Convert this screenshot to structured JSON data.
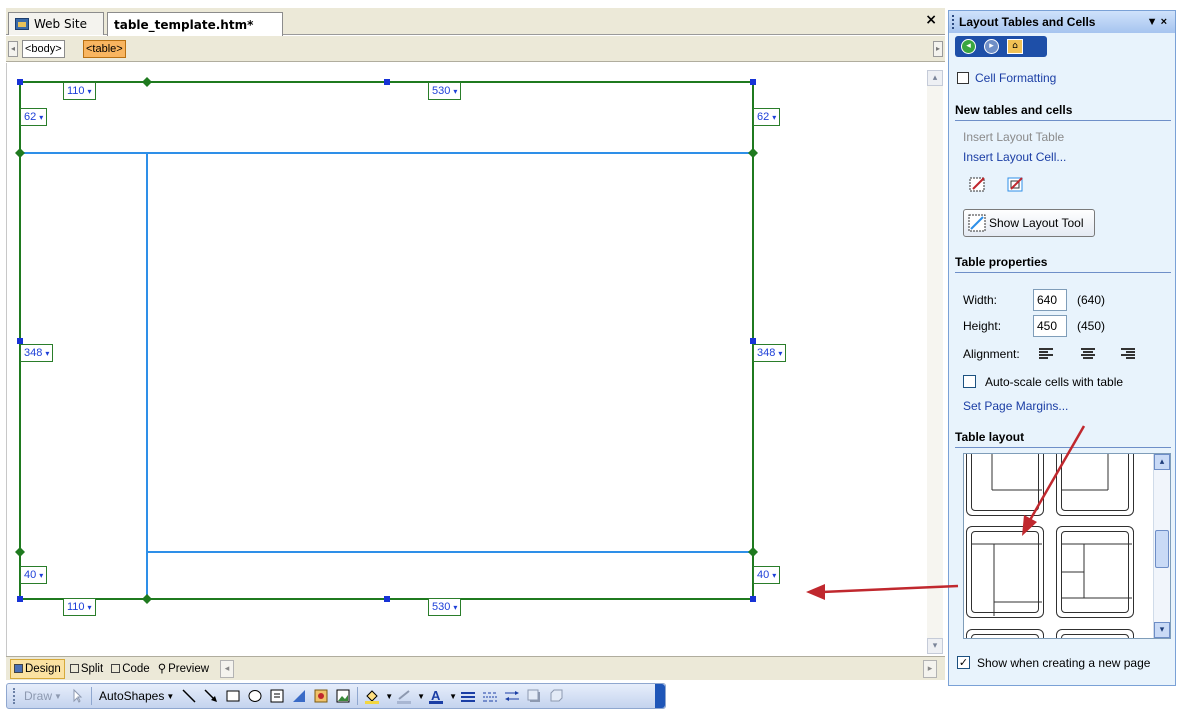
{
  "document": {
    "tabs": [
      {
        "label": "Web Site",
        "icon": "website-icon"
      },
      {
        "label": "table_template.htm*",
        "active": true
      }
    ],
    "close_glyph": "×"
  },
  "quick_tags": [
    "<body>",
    "<table>"
  ],
  "layout_table": {
    "top_widths": [
      "110",
      "530"
    ],
    "bottom_widths": [
      "110",
      "530"
    ],
    "left_heights": [
      "62",
      "348",
      "40"
    ],
    "right_heights": [
      "62",
      "348",
      "40"
    ],
    "border_color": "#1f7a1f",
    "cell_color": "#2e8fe8",
    "handle_color": "#1733d6"
  },
  "views": [
    {
      "label": "Design",
      "active": true
    },
    {
      "label": "Split"
    },
    {
      "label": "Code"
    },
    {
      "label": "Preview"
    }
  ],
  "draw_toolbar": {
    "draw": "Draw",
    "autoshapes": "AutoShapes"
  },
  "task_pane": {
    "title": "Layout Tables and Cells",
    "controls": "▼ ×",
    "cell_formatting": "Cell Formatting",
    "section_new": "New tables and cells",
    "insert_table": "Insert Layout Table",
    "insert_cell": "Insert Layout Cell...",
    "show_tool": "Show Layout Tool",
    "section_props": "Table properties",
    "width_label": "Width:",
    "width_value": "640",
    "width_note": "(640)",
    "height_label": "Height:",
    "height_value": "450",
    "height_note": "(450)",
    "alignment_label": "Alignment:",
    "autoscale_label": "Auto-scale cells with table",
    "autoscale_checked": false,
    "page_margins": "Set Page Margins...",
    "section_layout": "Table layout",
    "show_new_page": "Show when creating a new page",
    "show_new_page_checked": true
  },
  "colors": {
    "annotation_arrow": "#c0282e",
    "taskpane_bg": "#e8f3fc",
    "active_tag": "#f8b560"
  }
}
